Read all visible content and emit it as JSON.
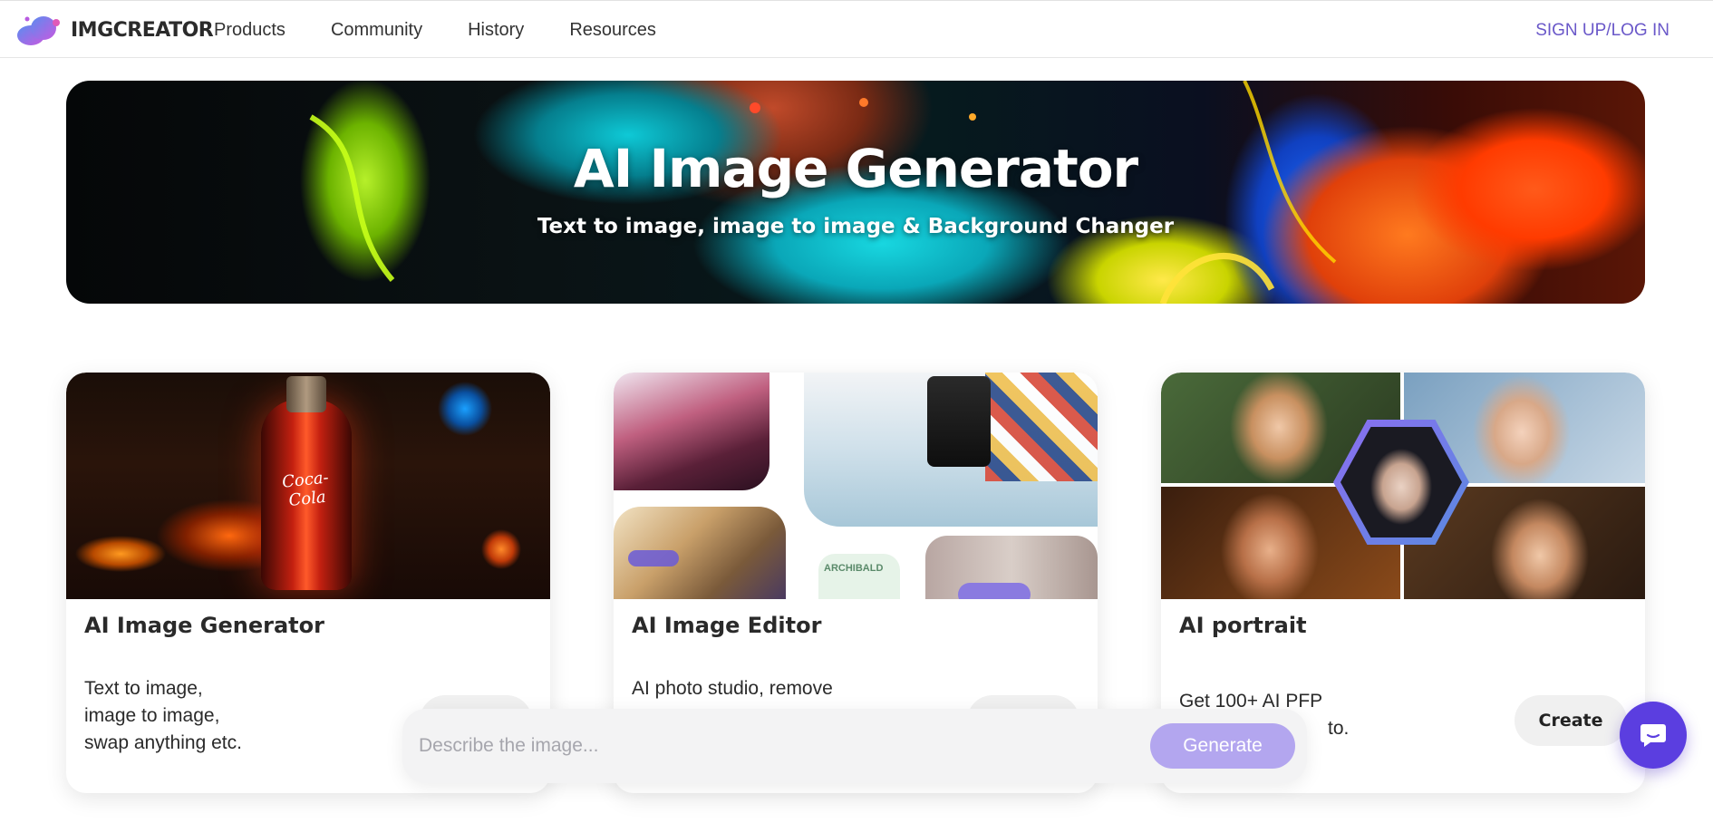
{
  "header": {
    "brand": "IMGCREATOR",
    "nav": [
      "Products",
      "Community",
      "History",
      "Resources"
    ],
    "signup": "SIGN UP/LOG IN"
  },
  "hero": {
    "title": "AI Image Generator",
    "subtitle": "Text to image, image to image & Background Changer"
  },
  "cards": [
    {
      "title": "AI Image Generator",
      "desc": [
        "Text to image,",
        "image to image,",
        "swap anything etc."
      ],
      "button": ""
    },
    {
      "title": "AI Image Editor",
      "desc": [
        "AI photo studio, remove"
      ],
      "button": ""
    },
    {
      "title": "AI portrait",
      "desc": [
        "Get 100+ AI PFP",
        "to."
      ],
      "button": "Create"
    }
  ],
  "card_images": {
    "card1_logo_text": "Coca-Cola",
    "card2_label": "ARCHIBALD"
  },
  "prompt": {
    "placeholder": "Describe the image...",
    "button": "Generate"
  },
  "colors": {
    "accent": "#6a58c9",
    "generate_button": "#b3a6ef",
    "chat_button": "#5b3ee0"
  },
  "icons": [
    "logo-icon",
    "chat-icon"
  ]
}
